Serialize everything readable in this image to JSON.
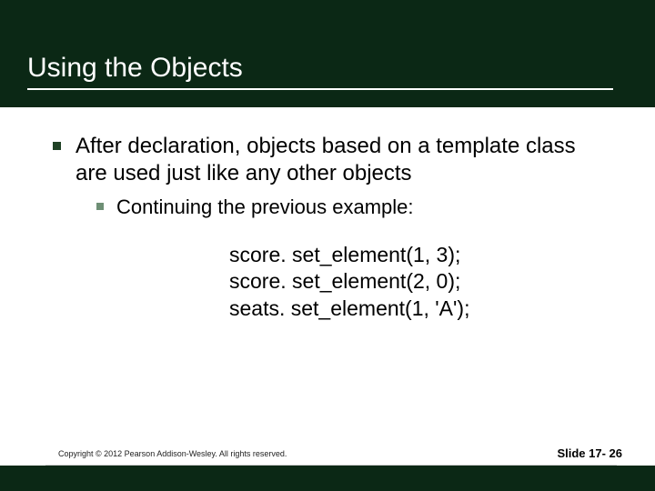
{
  "title": "Using the Objects",
  "body": {
    "lvl1": "After declaration, objects based on a template class are used just like any other objects",
    "lvl2": "Continuing the previous example:",
    "code": [
      "score. set_element(1, 3);",
      "score. set_element(2, 0);",
      "seats. set_element(1, 'A');"
    ]
  },
  "footer": {
    "copyright": "Copyright © 2012 Pearson Addison-Wesley.  All rights reserved.",
    "slide": "Slide 17- 26"
  }
}
